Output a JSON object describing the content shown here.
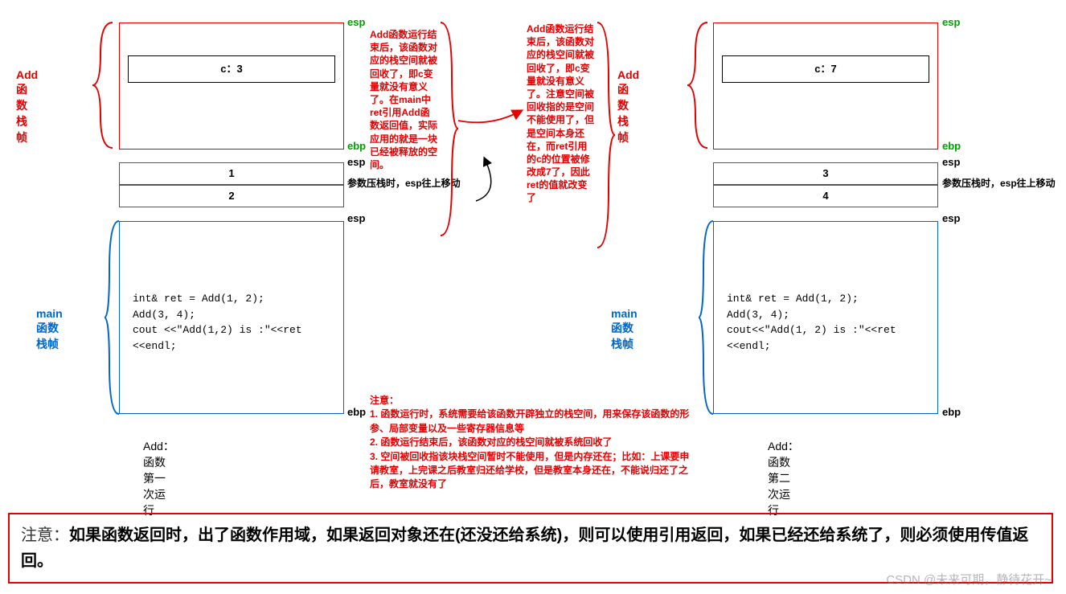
{
  "left": {
    "frame_add_label": "Add函数栈帧",
    "frame_main_label": "main函数栈帧",
    "add_box_cell": "c：3",
    "param1": "1",
    "param2": "2",
    "esp": "esp",
    "ebp": "ebp",
    "esp2": "esp",
    "ebp2": "ebp",
    "esp3": "esp",
    "push_note": "参数压栈时，esp往上移动",
    "code1": "int& ret = Add(1, 2);",
    "code2": "Add(3, 4);",
    "code3": "cout <<\"Add(1,2) is :\"<<ret <<endl;",
    "caption": "Add：函数第一次运行"
  },
  "center": {
    "explain1": "Add函数运行结束后，该函数对应的栈空间就被回收了，即c变量就没有意义了。在main中ret引用Add函数返回值，实际应用的就是一块已经被释放的空间。",
    "explain2": "Add函数运行结束后，该函数对应的栈空间就被回收了，即c变量就没有意义了。注意空间被回收指的是空间不能使用了，但是空间本身还在，而ret引用的c的位置被修改成7了，因此ret的值就改变了"
  },
  "right": {
    "frame_add_label": "Add函数栈帧",
    "frame_main_label": "main函数栈帧",
    "add_box_cell": "c：7",
    "param1": "3",
    "param2": "4",
    "esp": "esp",
    "ebp": "ebp",
    "esp2": "esp",
    "ebp2": "ebp",
    "esp3": "esp",
    "push_note": "参数压栈时，esp往上移动",
    "code1": "int& ret = Add(1, 2);",
    "code2": "Add(3, 4);",
    "code3": "cout<<\"Add(1, 2) is :\"<<ret <<endl;",
    "caption": "Add：函数第二次运行"
  },
  "notes": {
    "heading": "注意：",
    "n1": "1. 函数运行时，系统需要给该函数开辟独立的栈空间，用来保存该函数的形参、局部变量以及一些寄存器信息等",
    "n2": "2. 函数运行结束后，该函数对应的栈空间就被系统回收了",
    "n3": "3. 空间被回收指该块栈空间暂时不能使用，但是内存还在；比如：上课要申请教室，上完课之后教室归还给学校，但是教室本身还在，不能说归还了之后，教室就没有了"
  },
  "final": {
    "prefix": "注意：",
    "body": "如果函数返回时，出了函数作用域，如果返回对象还在(还没还给系统)，则可以使用引用返回，如果已经还给系统了，则必须使用传值返回。"
  },
  "watermark": "CSDN @未来可期，静待花开~"
}
